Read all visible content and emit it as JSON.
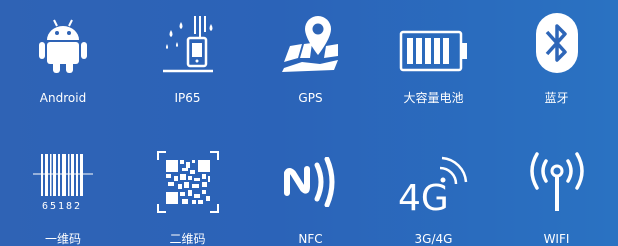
{
  "features": [
    {
      "label": "Android",
      "icon": "android-icon"
    },
    {
      "label": "IP65",
      "icon": "waterproof-device-icon"
    },
    {
      "label": "GPS",
      "icon": "map-pin-icon"
    },
    {
      "label": "大容量电池",
      "icon": "battery-icon"
    },
    {
      "label": "蓝牙",
      "icon": "bluetooth-icon"
    },
    {
      "label": "一维码",
      "icon": "barcode-icon",
      "code_digits": "65182"
    },
    {
      "label": "二维码",
      "icon": "qr-code-icon"
    },
    {
      "label": "NFC",
      "icon": "nfc-icon"
    },
    {
      "label": "3G/4G",
      "icon": "4g-signal-icon",
      "icon_text": "4G"
    },
    {
      "label": "WIFI",
      "icon": "wifi-antenna-icon"
    }
  ],
  "colors": {
    "background_start": "#2f63b5",
    "background_end": "#2a72c2",
    "foreground": "#ffffff"
  }
}
